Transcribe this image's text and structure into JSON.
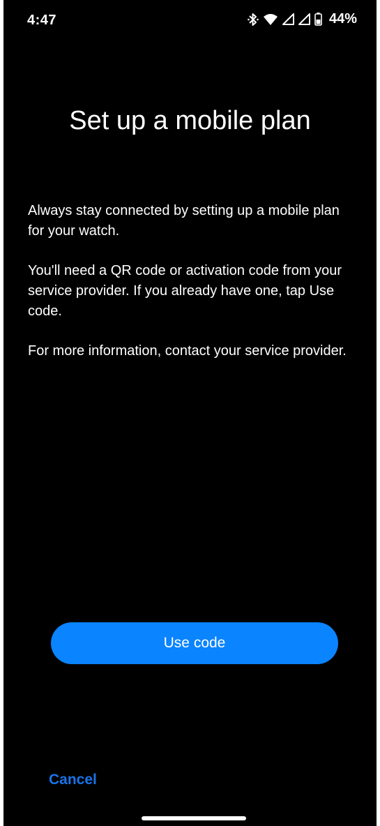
{
  "status_bar": {
    "time": "4:47",
    "battery_percent": "44%",
    "icons": [
      "bluetooth-icon",
      "wifi-icon",
      "signal-icon",
      "signal-icon",
      "battery-icon"
    ]
  },
  "screen": {
    "title": "Set up a mobile plan",
    "paragraphs": [
      "Always stay connected by setting up a mobile plan for your watch.",
      "You'll need a QR code or activation code from your service provider. If you already have one, tap Use code.",
      "For more information, contact your service provider."
    ]
  },
  "actions": {
    "primary_label": "Use code",
    "cancel_label": "Cancel"
  },
  "colors": {
    "background": "#000000",
    "primary_button": "#0a84ff",
    "cancel_text": "#1a73e8"
  }
}
